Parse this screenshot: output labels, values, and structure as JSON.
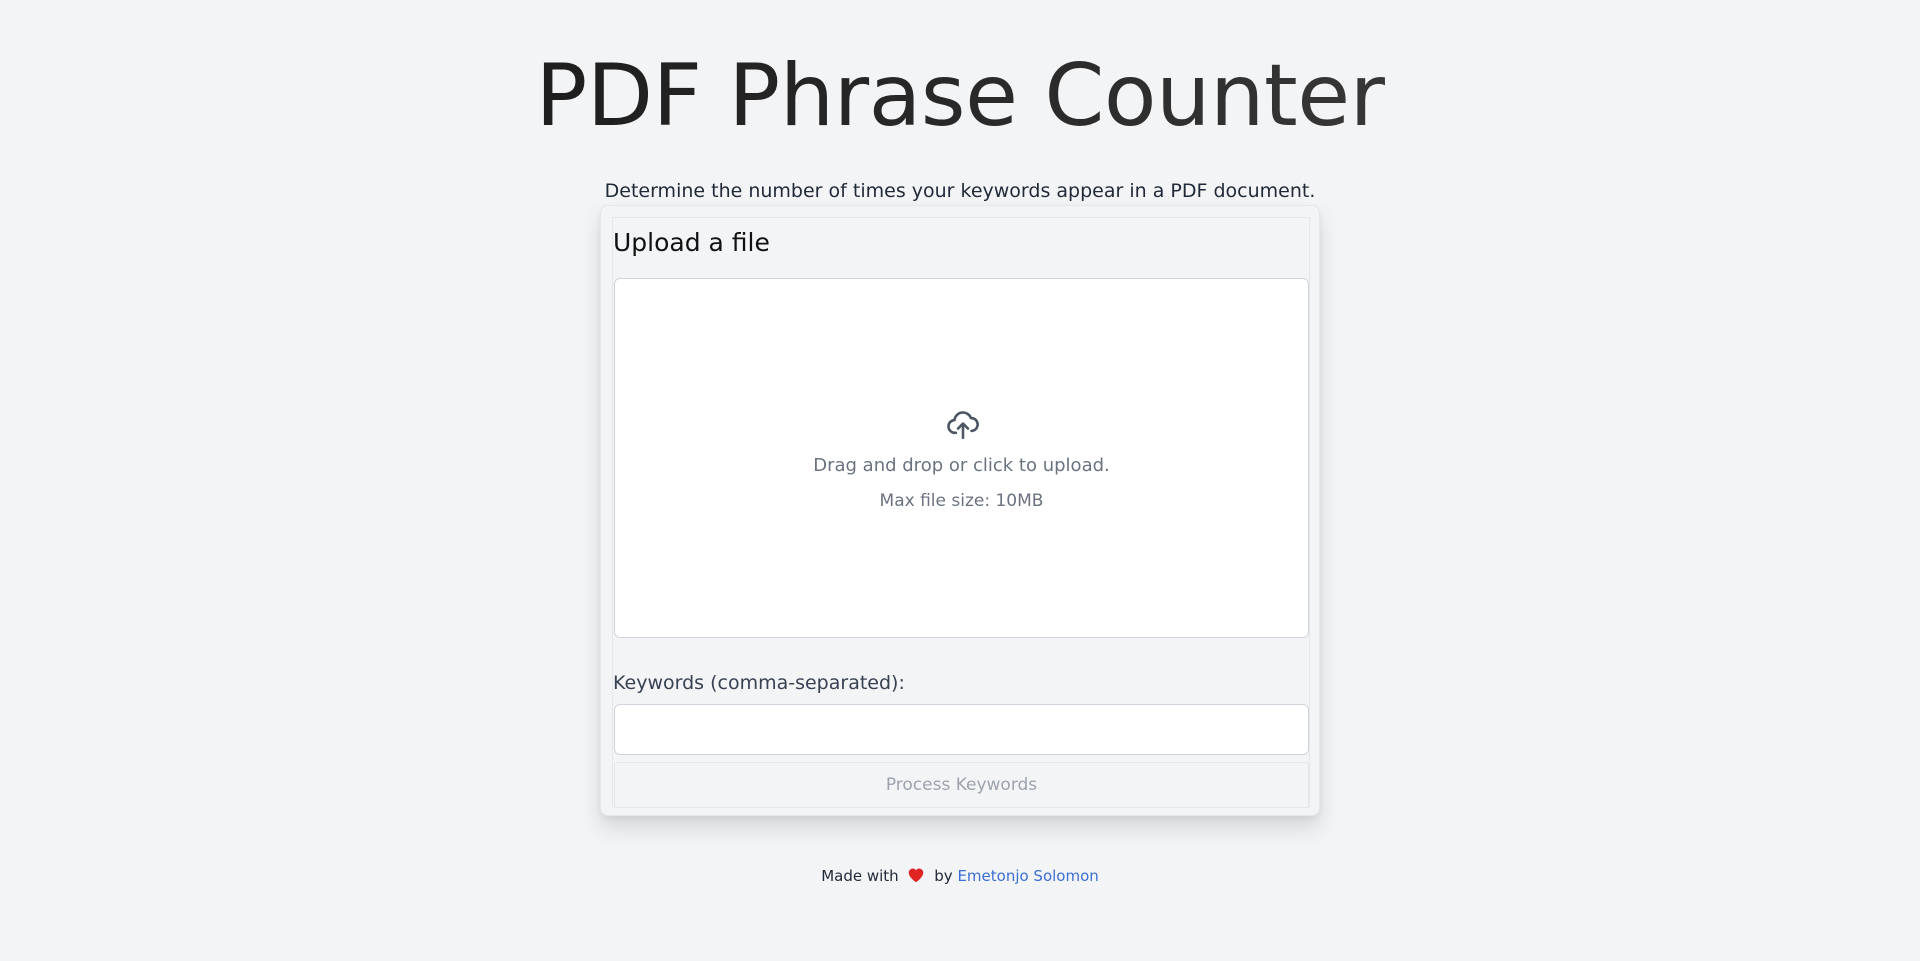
{
  "header": {
    "title": "PDF Phrase Counter",
    "subtitle": "Determine the number of times your keywords appear in a PDF document."
  },
  "upload": {
    "heading": "Upload a file",
    "icon": "cloud-upload-icon",
    "drop_text": "Drag and drop or click to upload.",
    "max_size_text": "Max file size: 10MB"
  },
  "keywords": {
    "label": "Keywords (comma-separated):",
    "value": "",
    "placeholder": ""
  },
  "process_button": {
    "label": "Process Keywords",
    "disabled": true
  },
  "footer": {
    "made_with": "Made with",
    "heart_icon": "heart-icon",
    "by": "by",
    "author": "Emetonjo Solomon"
  },
  "colors": {
    "background": "#f3f4f6",
    "link": "#3b6fd6",
    "heart": "#e02424",
    "muted_text": "#6b7280"
  }
}
